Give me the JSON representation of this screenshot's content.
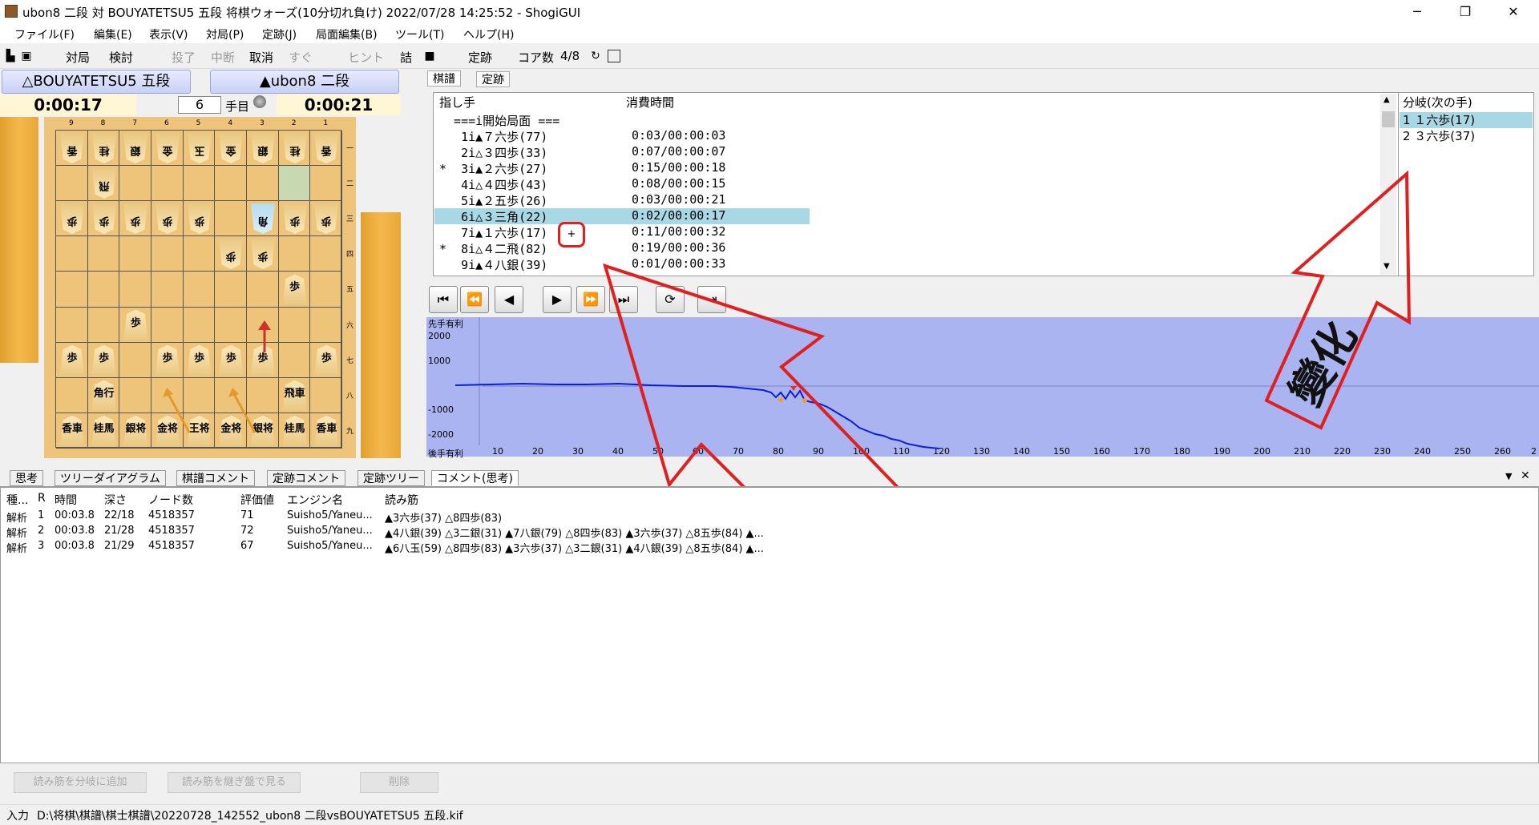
{
  "window": {
    "title": "ubon8 二段 対 BOUYATETSU5 五段 将棋ウォーズ(10分切れ負け) 2022/07/28 14:25:52 - ShogiGUI",
    "minimize": "─",
    "maximize": "❐",
    "close": "✕"
  },
  "menu": [
    "ファイル(F)",
    "編集(E)",
    "表示(V)",
    "対局(P)",
    "定跡(J)",
    "局面編集(B)",
    "ツール(T)",
    "ヘルプ(H)"
  ],
  "toolbar": {
    "play": "対局",
    "review": "検討",
    "resign": "投了",
    "pause": "中断",
    "undo": "取消",
    "now": "すぐ",
    "hint": "ヒント",
    "tsume": "詰",
    "joseki": "定跡",
    "cores": "コア数",
    "cores_value": "4/8"
  },
  "players": {
    "gote": "△BOUYATETSU5 五段",
    "sente": "▲ubon8 二段",
    "gote_time": "0:00:17",
    "sente_time": "0:00:21",
    "move_no": "6",
    "move_label": "手目"
  },
  "board": {
    "files": [
      "9",
      "8",
      "7",
      "6",
      "5",
      "4",
      "3",
      "2",
      "1"
    ],
    "ranks": [
      "一",
      "二",
      "三",
      "四",
      "五",
      "六",
      "七",
      "八",
      "九"
    ],
    "pieces": [
      {
        "f": 9,
        "r": 1,
        "c": "香",
        "g": true
      },
      {
        "f": 8,
        "r": 1,
        "c": "桂",
        "g": true
      },
      {
        "f": 7,
        "r": 1,
        "c": "銀",
        "g": true
      },
      {
        "f": 6,
        "r": 1,
        "c": "金",
        "g": true
      },
      {
        "f": 5,
        "r": 1,
        "c": "玉",
        "g": true
      },
      {
        "f": 4,
        "r": 1,
        "c": "金",
        "g": true
      },
      {
        "f": 3,
        "r": 1,
        "c": "銀",
        "g": true
      },
      {
        "f": 2,
        "r": 1,
        "c": "桂",
        "g": true
      },
      {
        "f": 1,
        "r": 1,
        "c": "香",
        "g": true
      },
      {
        "f": 8,
        "r": 2,
        "c": "飛",
        "g": true
      },
      {
        "f": 9,
        "r": 3,
        "c": "歩",
        "g": true
      },
      {
        "f": 8,
        "r": 3,
        "c": "歩",
        "g": true
      },
      {
        "f": 7,
        "r": 3,
        "c": "歩",
        "g": true
      },
      {
        "f": 6,
        "r": 3,
        "c": "歩",
        "g": true
      },
      {
        "f": 5,
        "r": 3,
        "c": "歩",
        "g": true
      },
      {
        "f": 3,
        "r": 3,
        "c": "角",
        "g": true,
        "sel": true
      },
      {
        "f": 2,
        "r": 3,
        "c": "歩",
        "g": true
      },
      {
        "f": 1,
        "r": 3,
        "c": "歩",
        "g": true
      },
      {
        "f": 4,
        "r": 4,
        "c": "歩",
        "g": true
      },
      {
        "f": 3,
        "r": 4,
        "c": "歩",
        "g": true
      },
      {
        "f": 2,
        "r": 5,
        "c": "歩",
        "g": false
      },
      {
        "f": 7,
        "r": 6,
        "c": "歩",
        "g": false
      },
      {
        "f": 9,
        "r": 7,
        "c": "歩",
        "g": false
      },
      {
        "f": 8,
        "r": 7,
        "c": "歩",
        "g": false
      },
      {
        "f": 6,
        "r": 7,
        "c": "歩",
        "g": false
      },
      {
        "f": 5,
        "r": 7,
        "c": "歩",
        "g": false
      },
      {
        "f": 4,
        "r": 7,
        "c": "歩",
        "g": false
      },
      {
        "f": 3,
        "r": 7,
        "c": "歩",
        "g": false
      },
      {
        "f": 1,
        "r": 7,
        "c": "歩",
        "g": false
      },
      {
        "f": 8,
        "r": 8,
        "c": "角行",
        "g": false
      },
      {
        "f": 2,
        "r": 8,
        "c": "飛車",
        "g": false
      },
      {
        "f": 9,
        "r": 9,
        "c": "香車",
        "g": false
      },
      {
        "f": 8,
        "r": 9,
        "c": "桂馬",
        "g": false
      },
      {
        "f": 7,
        "r": 9,
        "c": "銀将",
        "g": false
      },
      {
        "f": 6,
        "r": 9,
        "c": "金将",
        "g": false
      },
      {
        "f": 5,
        "r": 9,
        "c": "王将",
        "g": false
      },
      {
        "f": 4,
        "r": 9,
        "c": "金将",
        "g": false
      },
      {
        "f": 3,
        "r": 9,
        "c": "銀将",
        "g": false
      },
      {
        "f": 2,
        "r": 9,
        "c": "桂馬",
        "g": false
      },
      {
        "f": 1,
        "r": 9,
        "c": "香車",
        "g": false
      }
    ]
  },
  "kifu": {
    "tabs": [
      "棋譜",
      "定跡"
    ],
    "col_move": "指し手",
    "col_time": "消費時間",
    "rows": [
      {
        "m": "  ===i開始局面 ===",
        "t": ""
      },
      {
        "m": "   1i▲７六歩(77)",
        "t": "0:03/00:00:03"
      },
      {
        "m": "   2i△３四歩(33)",
        "t": "0:07/00:00:07"
      },
      {
        "m": "*  3i▲２六歩(27)",
        "t": "0:15/00:00:18"
      },
      {
        "m": "   4i△４四歩(43)",
        "t": "0:08/00:00:15"
      },
      {
        "m": "   5i▲２五歩(26)",
        "t": "0:03/00:00:21"
      },
      {
        "m": "   6i△３三角(22)",
        "t": "0:02/00:00:17"
      },
      {
        "m": "   7i▲１六歩(17)",
        "t": "0:11/00:00:32"
      },
      {
        "m": "*  8i△４二飛(82)",
        "t": "0:19/00:00:36"
      },
      {
        "m": "   9i▲４八銀(39)",
        "t": "0:01/00:00:33"
      }
    ],
    "plus": "+"
  },
  "branch": {
    "title": "分岐(次の手)",
    "items": [
      "1 １六歩(17)",
      "2 ３六歩(37)"
    ]
  },
  "graph": {
    "top_label": "先手有利",
    "bottom_label": "後手有利",
    "y_ticks": [
      "2000",
      "1000",
      "-1000",
      "-2000"
    ],
    "x_ticks": [
      "10",
      "20",
      "30",
      "40",
      "50",
      "60",
      "70",
      "80",
      "90",
      "100",
      "110",
      "120",
      "130",
      "140",
      "150",
      "160",
      "170",
      "180",
      "190",
      "200",
      "210",
      "220",
      "230",
      "240",
      "250",
      "260",
      "2"
    ]
  },
  "annotation": {
    "text": "變化"
  },
  "bottom_tabs": [
    "思考",
    "ツリーダイアグラム",
    "棋譜コメント",
    "定跡コメント",
    "定跡ツリー",
    "コメント(思考)"
  ],
  "analysis": {
    "headers": [
      "種...",
      "R",
      "時間",
      "深さ",
      "ノード数",
      "評価値",
      "エンジン名",
      "読み筋"
    ],
    "rows": [
      [
        "解析",
        "1",
        "00:03.8",
        "22/18",
        "4518357",
        "71",
        "Suisho5/Yaneu...",
        "▲3六歩(37) △8四歩(83)"
      ],
      [
        "解析",
        "2",
        "00:03.8",
        "21/28",
        "4518357",
        "72",
        "Suisho5/Yaneu...",
        "▲4八銀(39) △3二銀(31) ▲7八銀(79) △8四歩(83) ▲3六歩(37) △8五歩(84) ▲..."
      ],
      [
        "解析",
        "3",
        "00:03.8",
        "21/29",
        "4518357",
        "67",
        "Suisho5/Yaneu...",
        "▲6八玉(59) △8四歩(83) ▲3六歩(37) △3二銀(31) ▲4八銀(39) △8五歩(84) ▲..."
      ]
    ],
    "btn_add": "読み筋を分岐に追加",
    "btn_view": "読み筋を継ぎ盤で見る",
    "btn_delete": "削除"
  },
  "status": {
    "mode": "入力",
    "path": "D:\\将棋\\棋譜\\棋士棋譜\\20220728_142552_ubon8 二段vsBOUYATETSU5 五段.kif"
  }
}
